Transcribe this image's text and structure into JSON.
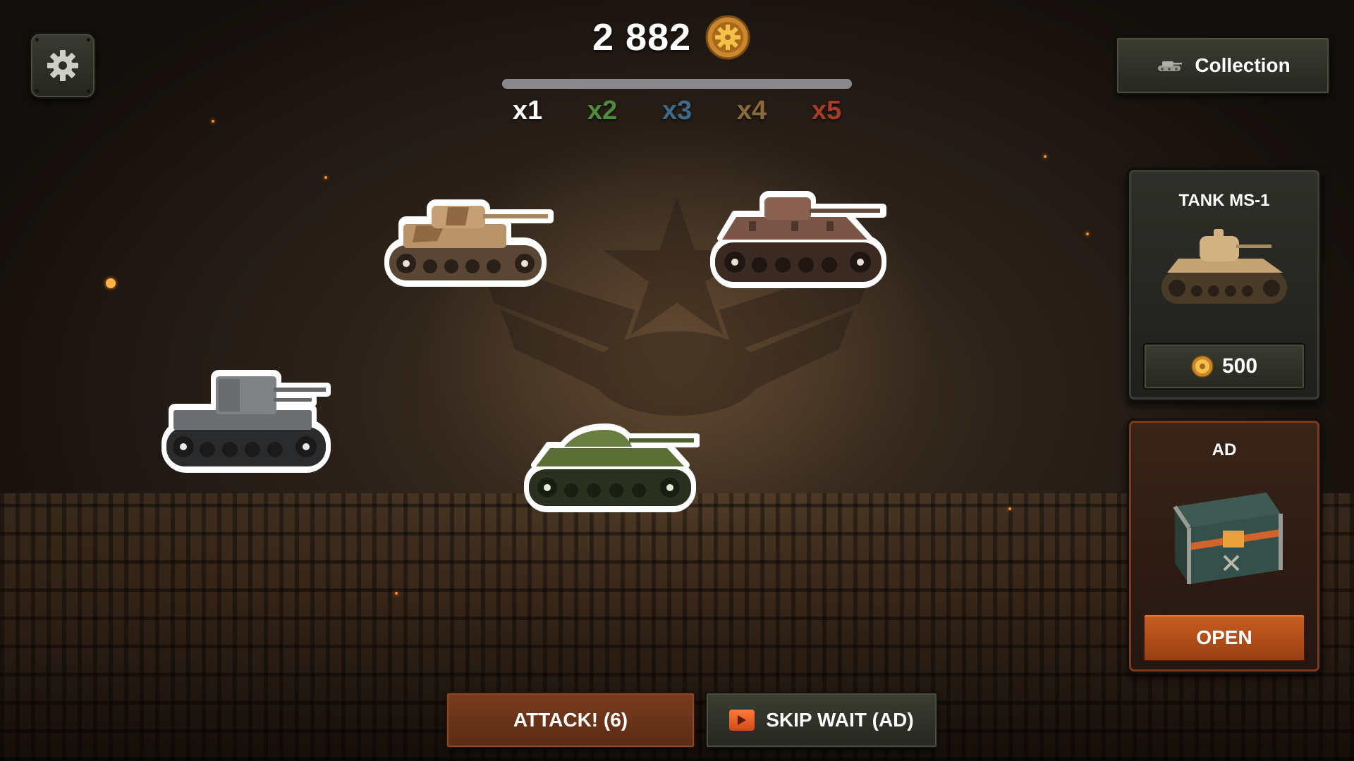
{
  "hud": {
    "coin_value": "2 882",
    "coin_icon": "gear-coin-icon",
    "progress_fraction": 1.0,
    "multipliers": [
      {
        "label": "x1",
        "color": "#ffffff"
      },
      {
        "label": "x2",
        "color": "#4e8b3a"
      },
      {
        "label": "x3",
        "color": "#3d6a8a"
      },
      {
        "label": "x4",
        "color": "#8a6a3a"
      },
      {
        "label": "x5",
        "color": "#a83a2a"
      }
    ]
  },
  "collection": {
    "label": "Collection",
    "icon": "tank-icon"
  },
  "shop": {
    "title": "TANK MS-1",
    "price": "500",
    "price_icon": "gear-coin-icon"
  },
  "ad_box": {
    "title": "AD",
    "button_label": "OPEN",
    "icon": "crate-icon"
  },
  "actions": {
    "attack_label": "ATTACK! (6)",
    "skip_label": "SKIP WAIT (AD)",
    "skip_icon": "play-icon"
  },
  "tanks": [
    {
      "name": "desert-camo-tank",
      "color": "#b89468"
    },
    {
      "name": "rusty-brown-tank",
      "color": "#7a5646"
    },
    {
      "name": "grey-tank",
      "color": "#6d6e70"
    },
    {
      "name": "green-tank",
      "color": "#5a6e36"
    }
  ],
  "colors": {
    "accent_orange": "#c85e22",
    "panel_dark": "#2f2f2a",
    "text": "#ffffff"
  }
}
